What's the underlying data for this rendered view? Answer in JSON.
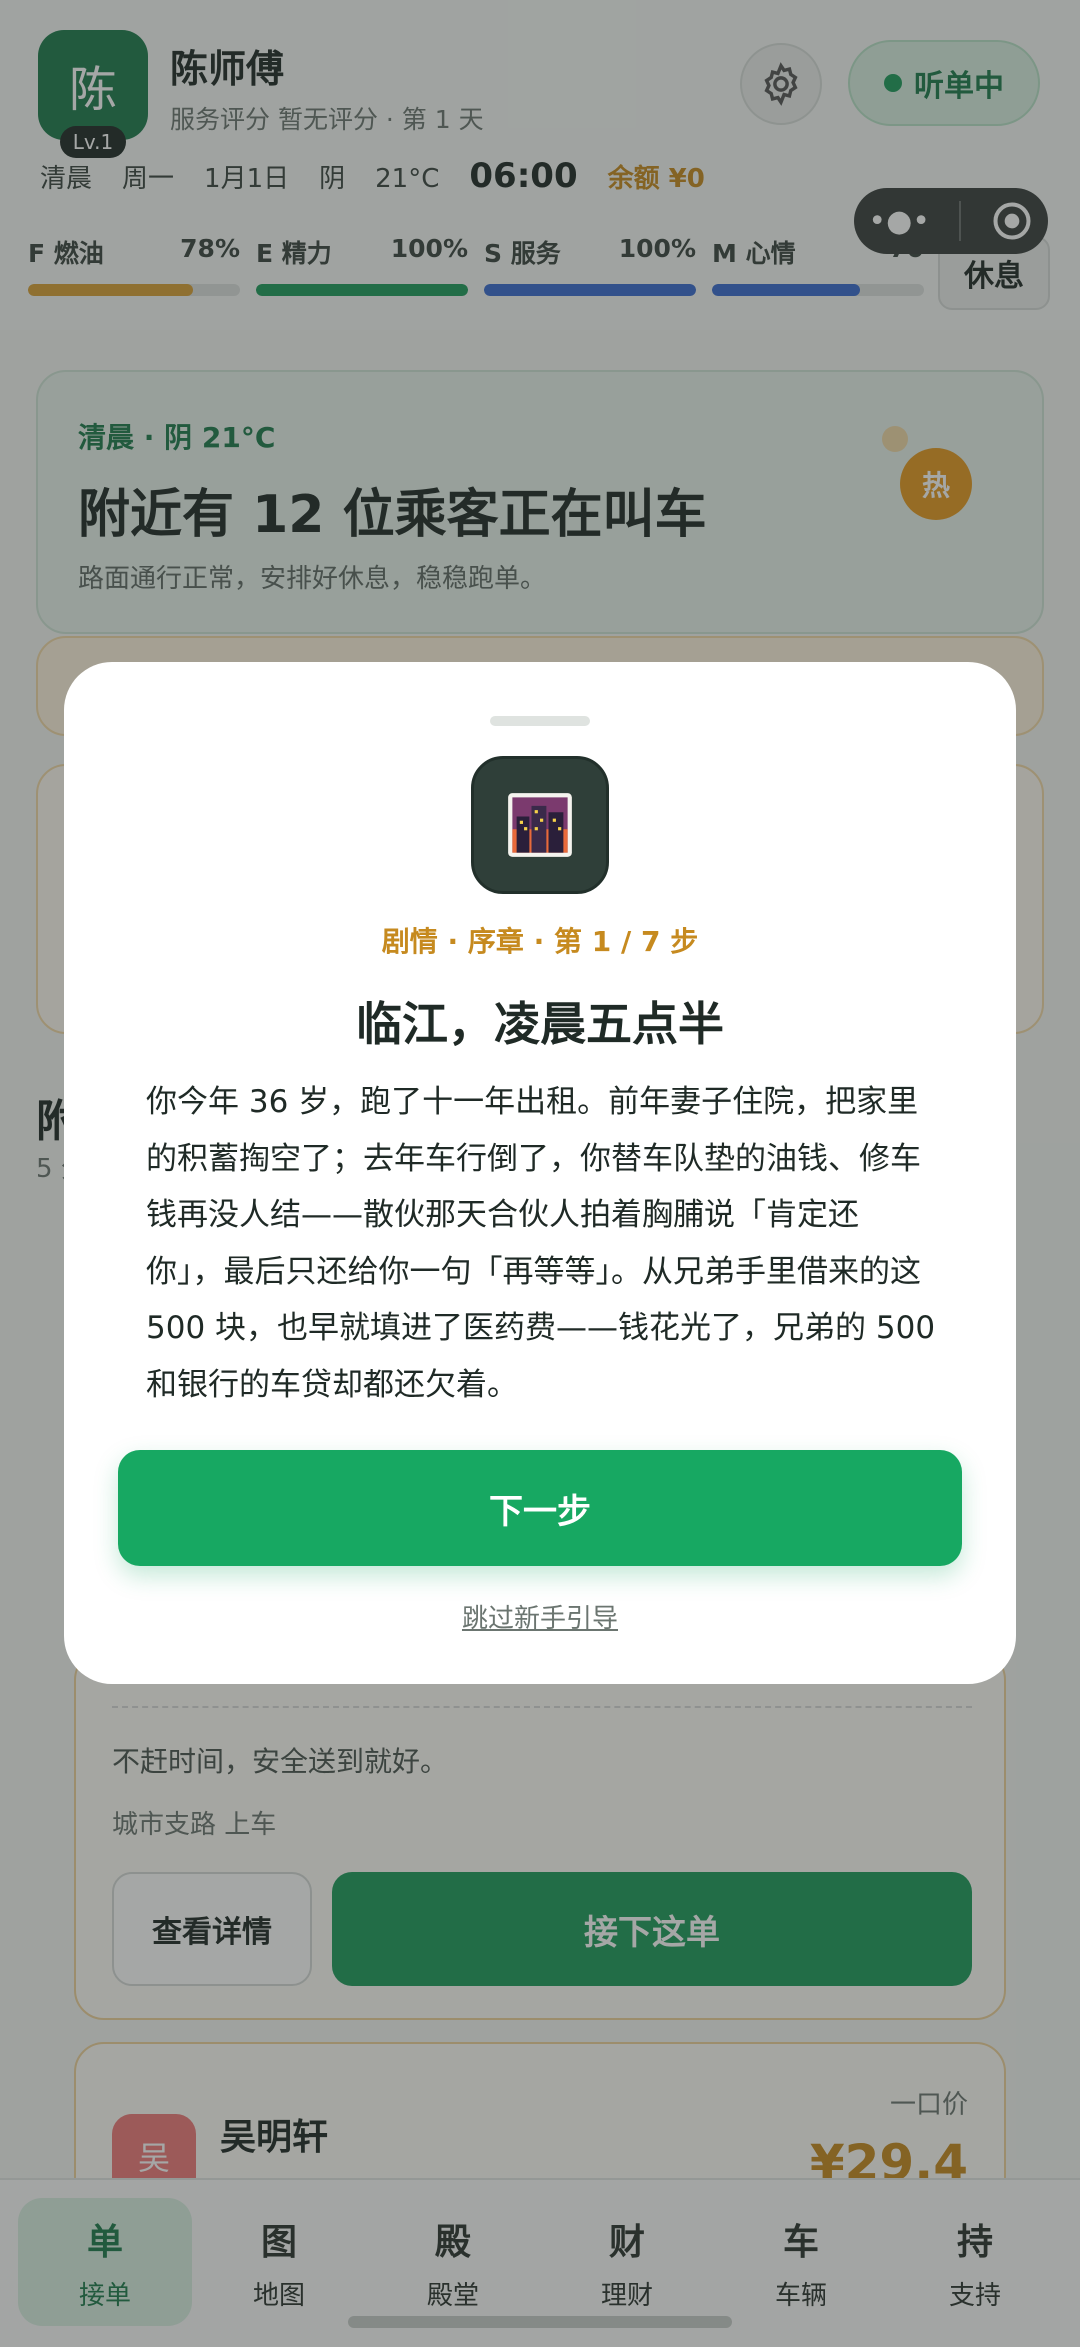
{
  "header": {
    "avatar_char": "陈",
    "level": "Lv.1",
    "name": "陈师傅",
    "subtitle": "服务评分 暂无评分 · 第 1 天",
    "status_label": "听单中",
    "info": {
      "period": "清晨",
      "weekday": "周一",
      "date": "1月1日",
      "weather": "阴",
      "temp": "21°C",
      "time": "06:00",
      "balance": "余额 ¥0"
    },
    "rest_label": "休息",
    "stats": [
      {
        "label": "F 燃油",
        "value_text": "78%",
        "value": 78,
        "color": "#d9a036"
      },
      {
        "label": "E 精力",
        "value_text": "100%",
        "value": 100,
        "color": "#1e9b5c"
      },
      {
        "label": "S 服务",
        "value_text": "100%",
        "value": 100,
        "color": "#3a6bd1"
      },
      {
        "label": "M 心情",
        "value_text": "70",
        "value": 70,
        "color": "#3a6bd1"
      }
    ]
  },
  "hero": {
    "tag": "清晨 · 阴 21°C",
    "title": "附近有 12 位乘客正在叫车",
    "subtitle": "路面通行正常，安排好休息，稳稳跑单。",
    "hot_badge": "热"
  },
  "side_fragment": {
    "char": "附",
    "sub": "5 分"
  },
  "order": {
    "note": "不赶时间，安全送到就好。",
    "location": "城市支路 上车",
    "detail_label": "查看详情",
    "accept_label": "接下这单"
  },
  "order2": {
    "avatar_char": "吴",
    "name": "吴明轩",
    "fixed_label": "一口价",
    "price": "¥29.4"
  },
  "tabbar": [
    {
      "icon": "单",
      "label": "接单",
      "active": true
    },
    {
      "icon": "图",
      "label": "地图",
      "active": false
    },
    {
      "icon": "殿",
      "label": "殿堂",
      "active": false
    },
    {
      "icon": "财",
      "label": "理财",
      "active": false
    },
    {
      "icon": "车",
      "label": "车辆",
      "active": false
    },
    {
      "icon": "持",
      "label": "支持",
      "active": false
    }
  ],
  "modal": {
    "icon_name": "city-night-icon",
    "tag": "剧情 · 序章 · 第 1 / 7 步",
    "title": "临江，凌晨五点半",
    "body": "你今年 36 岁，跑了十一年出租。前年妻子住院，把家里的积蓄掏空了；去年车行倒了，你替车队垫的油钱、修车钱再没人结——散伙那天合伙人拍着胸脯说「肯定还你」，最后只还给你一句「再等等」。从兄弟手里借来的这 500 块，也早就填进了医药费——钱花光了，兄弟的 500 和银行的车贷却都还欠着。",
    "next_label": "下一步",
    "skip_label": "跳过新手引导"
  }
}
